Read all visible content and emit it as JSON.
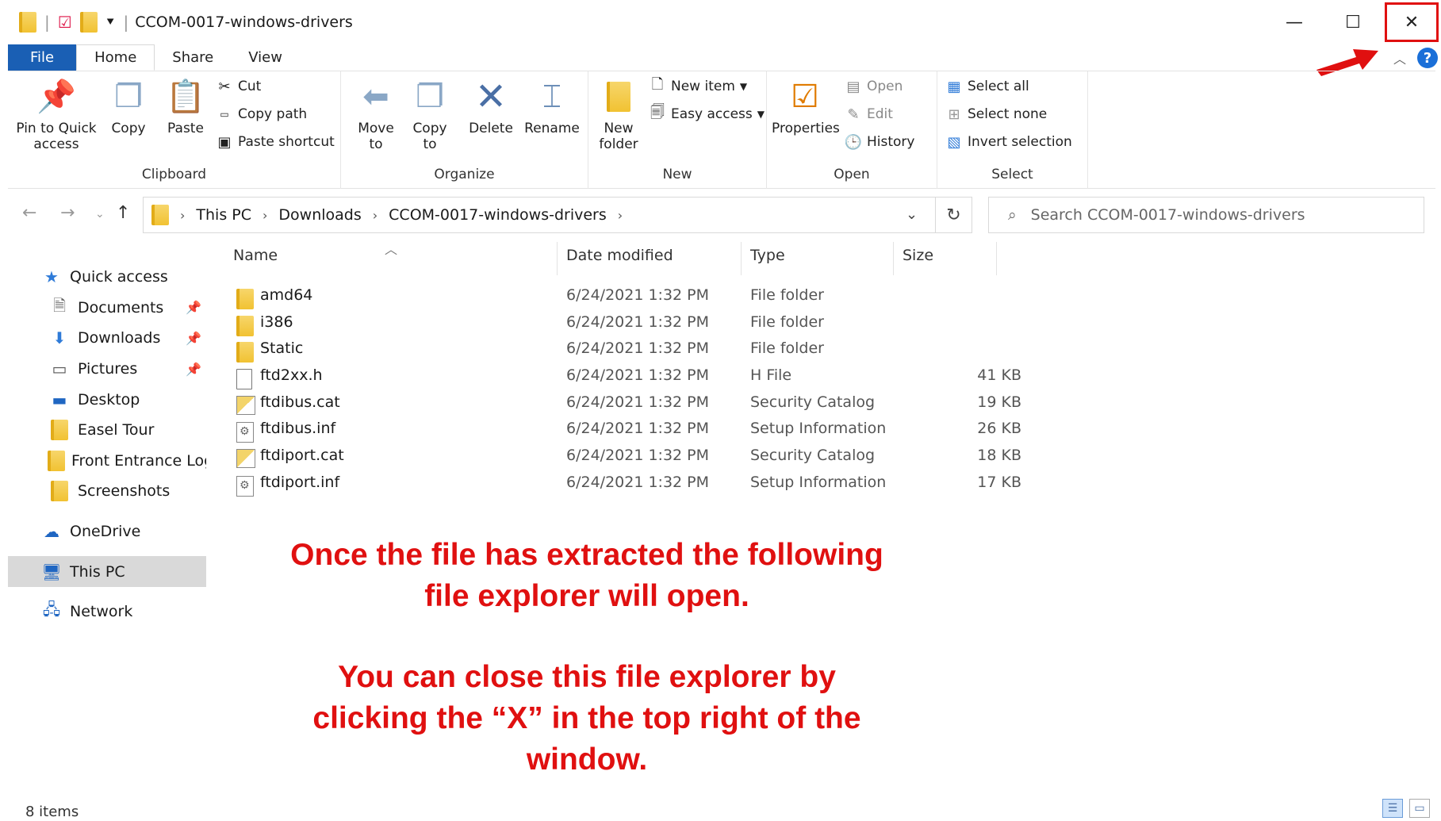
{
  "window": {
    "title": "CCOM-0017-windows-drivers",
    "minimize": "—",
    "maximize": "☐",
    "close": "✕"
  },
  "tabs": [
    "File",
    "Home",
    "Share",
    "View"
  ],
  "ribbon": {
    "clipboard": {
      "label": "Clipboard",
      "pin": "Pin to Quick access",
      "copy": "Copy",
      "paste": "Paste",
      "cut": "Cut",
      "copy_path": "Copy path",
      "paste_shortcut": "Paste shortcut"
    },
    "organize": {
      "label": "Organize",
      "move_to": "Move to",
      "copy_to": "Copy to",
      "delete": "Delete",
      "rename": "Rename"
    },
    "new": {
      "label": "New",
      "new_folder": "New folder",
      "new_item": "New item",
      "easy_access": "Easy access"
    },
    "open": {
      "label": "Open",
      "properties": "Properties",
      "open": "Open",
      "edit": "Edit",
      "history": "History"
    },
    "select": {
      "label": "Select",
      "select_all": "Select all",
      "select_none": "Select none",
      "invert": "Invert selection"
    }
  },
  "address": {
    "crumbs": [
      "This PC",
      "Downloads",
      "CCOM-0017-windows-drivers"
    ],
    "search_placeholder": "Search CCOM-0017-windows-drivers"
  },
  "nav": {
    "quick_access": "Quick access",
    "items": [
      "Documents",
      "Downloads",
      "Pictures",
      "Desktop",
      "Easel Tour",
      "Front Entrance Logo",
      "Screenshots"
    ],
    "onedrive": "OneDrive",
    "this_pc": "This PC",
    "network": "Network"
  },
  "columns": {
    "name": "Name",
    "date": "Date modified",
    "type": "Type",
    "size": "Size"
  },
  "files": [
    {
      "name": "amd64",
      "date": "6/24/2021 1:32 PM",
      "type": "File folder",
      "size": ""
    },
    {
      "name": "i386",
      "date": "6/24/2021 1:32 PM",
      "type": "File folder",
      "size": ""
    },
    {
      "name": "Static",
      "date": "6/24/2021 1:32 PM",
      "type": "File folder",
      "size": ""
    },
    {
      "name": "ftd2xx.h",
      "date": "6/24/2021 1:32 PM",
      "type": "H File",
      "size": "41 KB"
    },
    {
      "name": "ftdibus.cat",
      "date": "6/24/2021 1:32 PM",
      "type": "Security Catalog",
      "size": "19 KB"
    },
    {
      "name": "ftdibus.inf",
      "date": "6/24/2021 1:32 PM",
      "type": "Setup Information",
      "size": "26 KB"
    },
    {
      "name": "ftdiport.cat",
      "date": "6/24/2021 1:32 PM",
      "type": "Security Catalog",
      "size": "18 KB"
    },
    {
      "name": "ftdiport.inf",
      "date": "6/24/2021 1:32 PM",
      "type": "Setup Information",
      "size": "17 KB"
    }
  ],
  "annotation": {
    "line1": "Once the file has extracted the following",
    "line2": "file explorer will open.",
    "line3": "You can close this file explorer by",
    "line4": "clicking the “X” in the top right of the",
    "line5": "window."
  },
  "status": {
    "count": "8 items"
  },
  "colors": {
    "accent": "#1a5fb4",
    "annotation": "#e01010",
    "folder": "#f1c232"
  }
}
